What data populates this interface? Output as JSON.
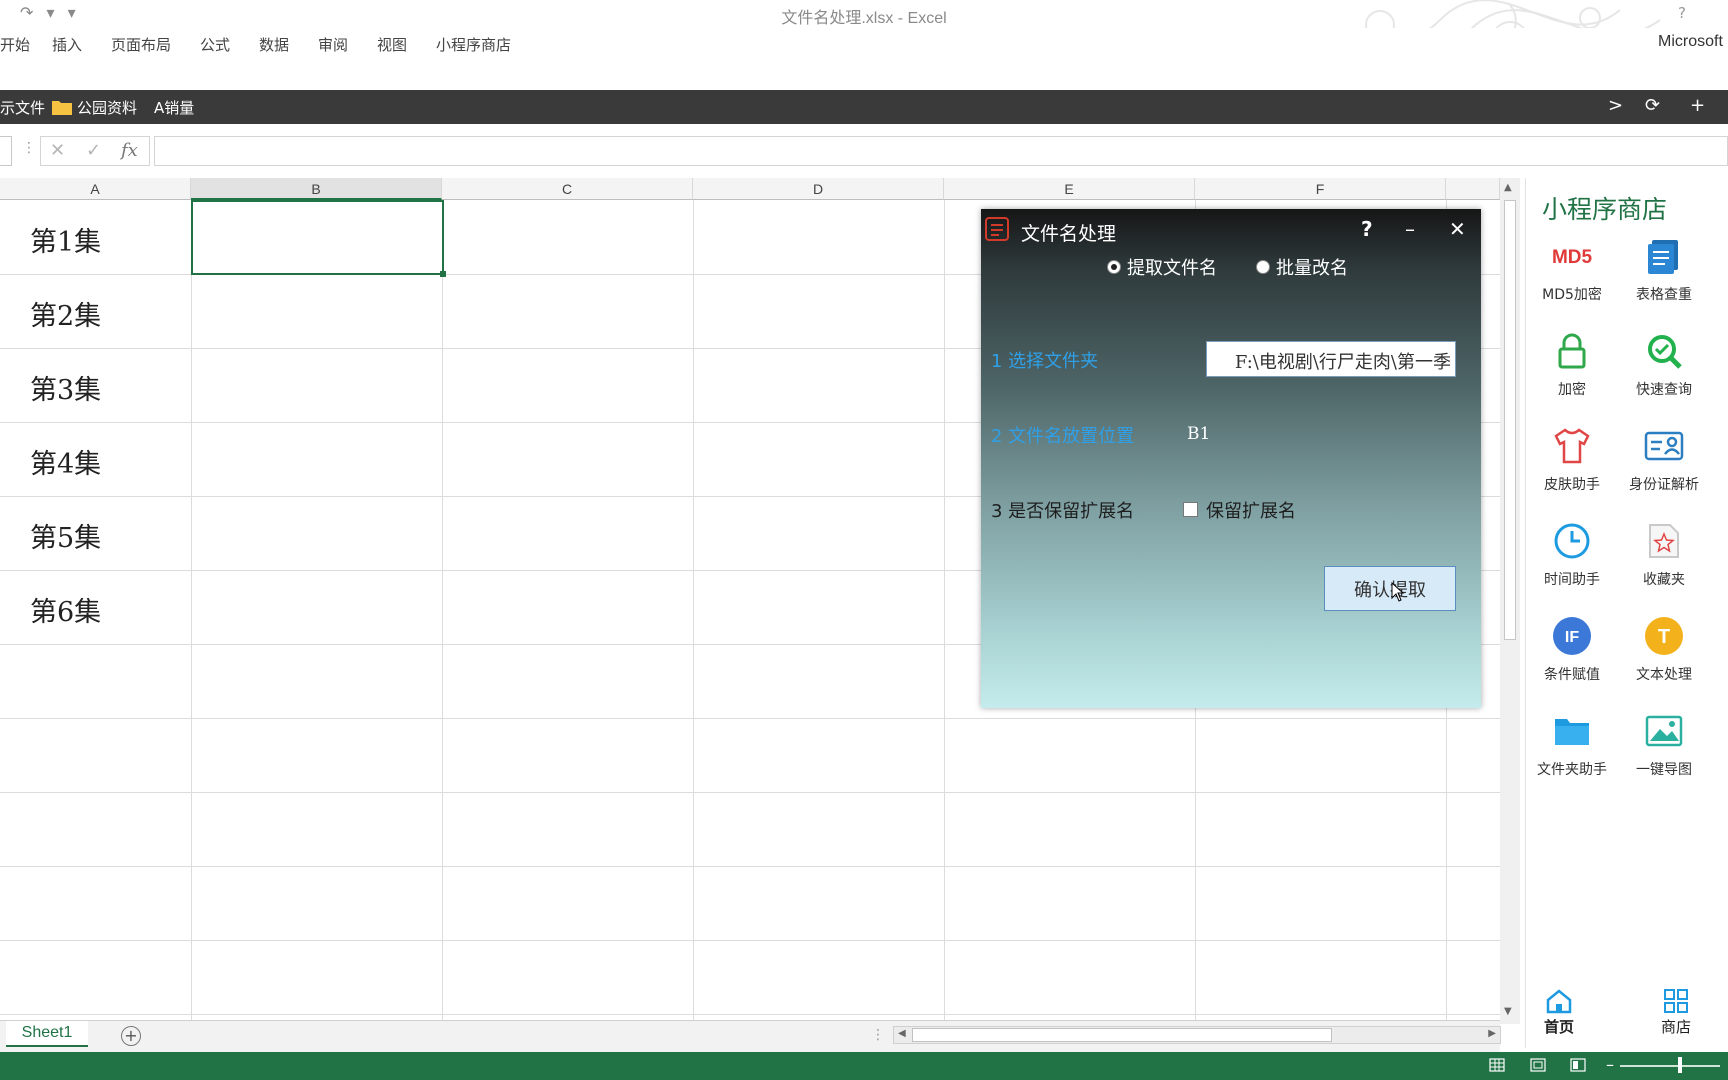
{
  "window": {
    "title": "文件名处理.xlsx - Excel",
    "help": "?",
    "quick_access": "↷ ▾ ▾",
    "account": "Microsoft"
  },
  "ribbon_tabs": [
    "开始",
    "插入",
    "页面布局",
    "公式",
    "数据",
    "审阅",
    "视图",
    "小程序商店"
  ],
  "file_tabs": {
    "items": [
      "示文件",
      "公园资料",
      "A销量"
    ],
    "next": ">",
    "refresh": "⟳",
    "add": "+"
  },
  "formula_bar": {
    "cancel": "✕",
    "enter": "✓",
    "fx": "fx",
    "value": ""
  },
  "columns": [
    "A",
    "B",
    "C",
    "D",
    "E",
    "F"
  ],
  "selected_column": "B",
  "rows": [
    {
      "a": "第1集"
    },
    {
      "a": "第2集"
    },
    {
      "a": "第3集"
    },
    {
      "a": "第4集"
    },
    {
      "a": "第5集"
    },
    {
      "a": "第6集"
    }
  ],
  "dialog": {
    "title": "文件名处理",
    "help": "?",
    "minimize": "–",
    "close": "✕",
    "mode_options": [
      {
        "label": "提取文件名",
        "selected": true
      },
      {
        "label": "批量改名",
        "selected": false
      }
    ],
    "step1_label": "1  选择文件夹",
    "folder_path": "F:\\电视剧\\行尸走肉\\第一季",
    "step2_label": "2  文件名放置位置",
    "position_value": "B1",
    "step3_label": "3  是否保留扩展名",
    "keep_ext_label": "保留扩展名",
    "keep_ext_checked": false,
    "confirm_label": "确认提取"
  },
  "side_panel": {
    "title": "小程序商店",
    "items": [
      {
        "label": "MD5加密",
        "icon": "md5-icon"
      },
      {
        "label": "表格查重",
        "icon": "table-dedupe-icon"
      },
      {
        "label": "加密",
        "icon": "lock-icon"
      },
      {
        "label": "快速查询",
        "icon": "search-icon"
      },
      {
        "label": "皮肤助手",
        "icon": "shirt-icon"
      },
      {
        "label": "身份证解析",
        "icon": "id-card-icon"
      },
      {
        "label": "时间助手",
        "icon": "clock-icon"
      },
      {
        "label": "收藏夹",
        "icon": "star-folder-icon"
      },
      {
        "label": "条件赋值",
        "icon": "if-icon"
      },
      {
        "label": "文本处理",
        "icon": "text-icon"
      },
      {
        "label": "文件夹助手",
        "icon": "folder-icon"
      },
      {
        "label": "一键导图",
        "icon": "image-icon"
      }
    ],
    "md5_glyph": "MD5",
    "if_glyph": "IF",
    "text_glyph": "T",
    "home_label": "首页",
    "store_label": "商店"
  },
  "sheets": {
    "active": "Sheet1",
    "add": "+"
  },
  "colors": {
    "excel_green": "#217346",
    "dialog_label_blue": "#2fa0e8"
  }
}
